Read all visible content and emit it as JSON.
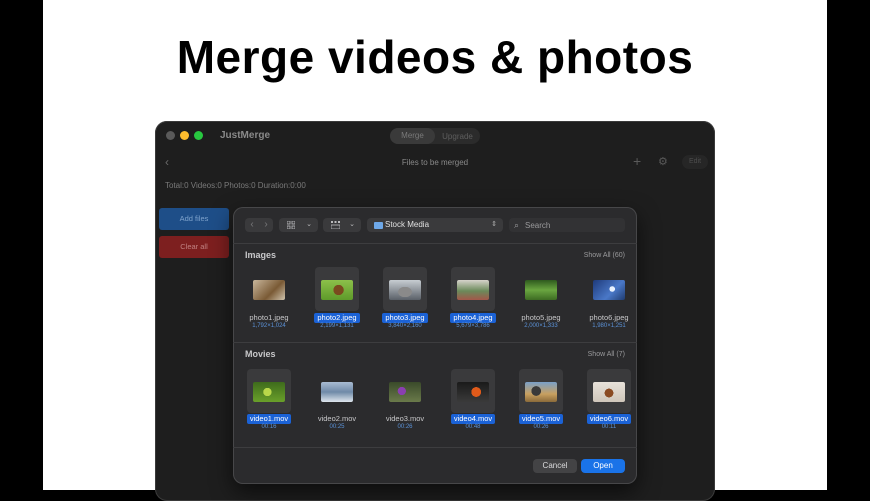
{
  "headline": "Merge videos & photos",
  "app": {
    "title": "JustMerge",
    "segments": [
      "Merge",
      "Upgrade"
    ],
    "toolbar_title": "Files to be merged",
    "edit_label": "Edit",
    "stats": "Total:0 Videos:0 Photos:0 Duration:0:00",
    "add_files": "Add files",
    "clear_all": "Clear all"
  },
  "dialog": {
    "view_icon_grid": "grid-icon",
    "view_icon_gallery": "gallery-icon",
    "location": "Stock Media",
    "search_placeholder": "Search",
    "images_title": "Images",
    "images_show_all": "Show All (60)",
    "movies_title": "Movies",
    "movies_show_all": "Show All (7)",
    "images": [
      {
        "name": "photo1.jpeg",
        "meta": "1,792×1,024",
        "selected": false
      },
      {
        "name": "photo2.jpeg",
        "meta": "2,199×1,131",
        "selected": true
      },
      {
        "name": "photo3.jpeg",
        "meta": "3,840×2,160",
        "selected": true
      },
      {
        "name": "photo4.jpeg",
        "meta": "5,679×3,786",
        "selected": true
      },
      {
        "name": "photo5.jpeg",
        "meta": "2,000×1,333",
        "selected": false
      },
      {
        "name": "photo6.jpeg",
        "meta": "1,980×1,251",
        "selected": false
      }
    ],
    "movies": [
      {
        "name": "video1.mov",
        "meta": "00:16",
        "selected": true
      },
      {
        "name": "video2.mov",
        "meta": "00:25",
        "selected": false
      },
      {
        "name": "video3.mov",
        "meta": "00:26",
        "selected": false
      },
      {
        "name": "video4.mov",
        "meta": "00:48",
        "selected": true
      },
      {
        "name": "video5.mov",
        "meta": "00:26",
        "selected": true
      },
      {
        "name": "video6.mov",
        "meta": "00:11",
        "selected": true
      }
    ],
    "cancel_label": "Cancel",
    "open_label": "Open"
  },
  "colors": {
    "accent": "#1a73e8",
    "selection": "#1b62d6",
    "danger": "#7d1f1f"
  }
}
